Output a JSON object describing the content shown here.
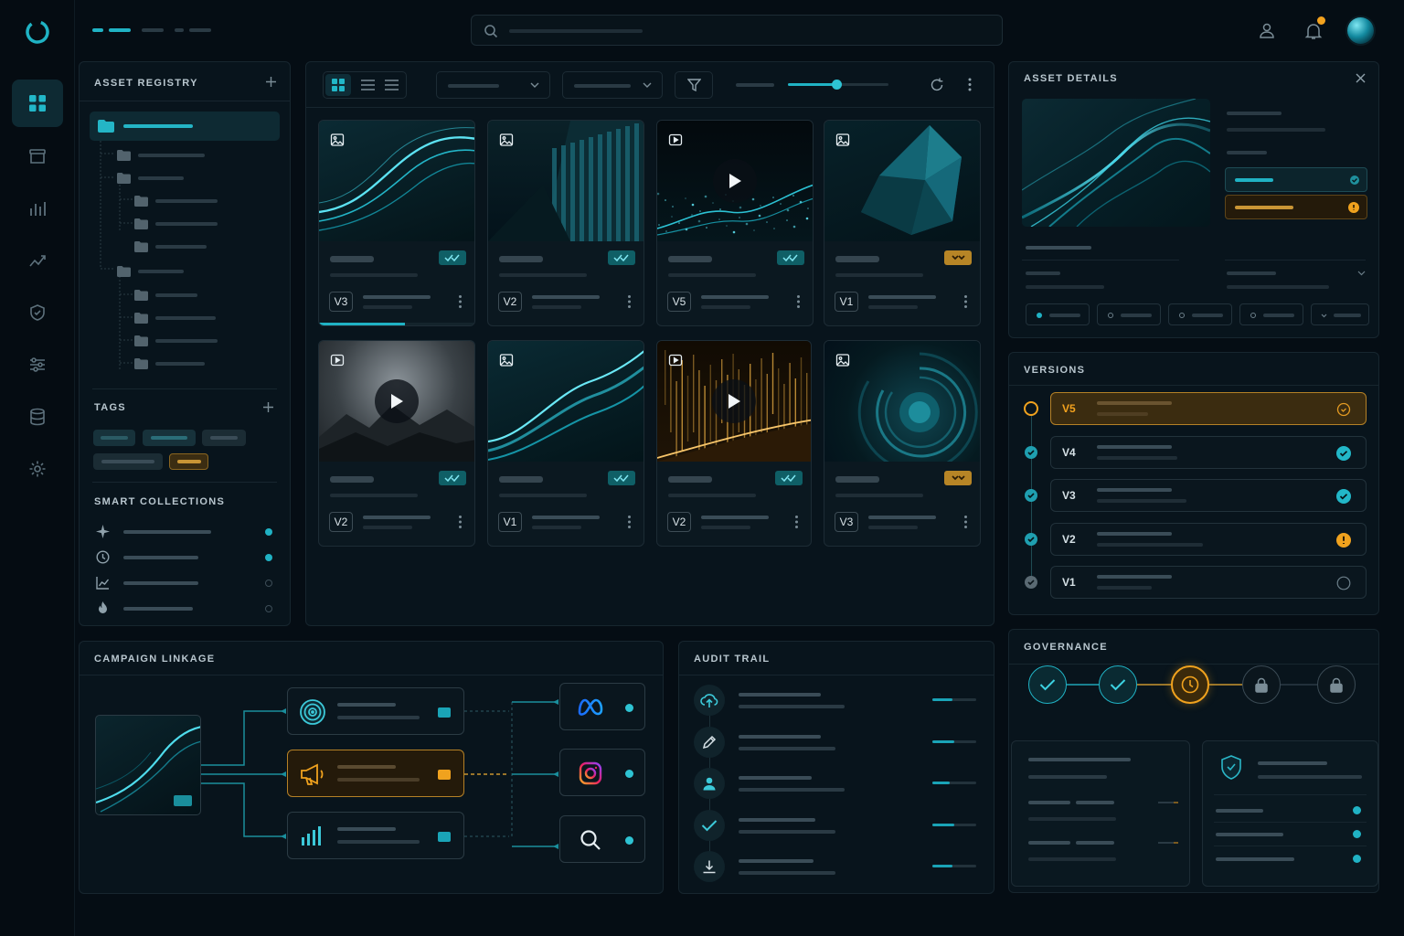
{
  "colors": {
    "bg": "#050d14",
    "panel": "#08141c",
    "accent": "#20b2c4",
    "warning": "#d99a2b",
    "border": "#17262f"
  },
  "rail": {
    "logo": "ring-logo-icon",
    "items": [
      {
        "icon": "grid-icon",
        "active": true
      },
      {
        "icon": "archive-icon"
      },
      {
        "icon": "bar-chart-icon"
      },
      {
        "icon": "trend-icon"
      },
      {
        "icon": "shield-icon"
      },
      {
        "icon": "sliders-icon"
      },
      {
        "icon": "database-icon"
      },
      {
        "icon": "settings-icon"
      }
    ]
  },
  "header": {
    "search_icon": "search-icon",
    "user_icon": "user-icon",
    "bell_icon": "bell-icon",
    "notification_dot": true
  },
  "registry": {
    "title": "ASSET REGISTRY",
    "tags_title": "TAGS",
    "smart_title": "SMART COLLECTIONS",
    "smart_items": [
      {
        "icon": "sparkle-icon",
        "active": true
      },
      {
        "icon": "clock-icon",
        "active": true
      },
      {
        "icon": "chart-icon",
        "active": false
      },
      {
        "icon": "flame-icon",
        "active": false
      }
    ]
  },
  "grid": {
    "cards": [
      {
        "type": "image",
        "version": "V3",
        "status": "ok",
        "progress": 0.55
      },
      {
        "type": "image",
        "version": "V2",
        "status": "ok"
      },
      {
        "type": "video",
        "version": "V5",
        "status": "ok"
      },
      {
        "type": "image",
        "version": "V1",
        "status": "warn"
      },
      {
        "type": "video",
        "version": "V2",
        "status": "ok"
      },
      {
        "type": "image",
        "version": "V1",
        "status": "ok"
      },
      {
        "type": "video",
        "version": "V2",
        "status": "ok"
      },
      {
        "type": "image",
        "version": "V3",
        "status": "warn"
      }
    ],
    "zoom_level": 0.48
  },
  "details": {
    "title": "ASSET DETAILS",
    "close_icon": "close-icon"
  },
  "versions": {
    "title": "VERSIONS",
    "items": [
      {
        "label": "V5",
        "state": "current",
        "status": "pending"
      },
      {
        "label": "V4",
        "state": "done",
        "status": "approved"
      },
      {
        "label": "V3",
        "state": "done",
        "status": "approved"
      },
      {
        "label": "V2",
        "state": "done",
        "status": "warning"
      },
      {
        "label": "V1",
        "state": "old",
        "status": "none"
      }
    ]
  },
  "governance": {
    "title": "GOVERNANCE",
    "steps": [
      "done",
      "done",
      "pending",
      "locked",
      "locked"
    ]
  },
  "campaign": {
    "title": "CAMPAIGN LINKAGE",
    "platforms": [
      "meta-icon",
      "instagram-icon",
      "search-icon"
    ]
  },
  "audit": {
    "title": "AUDIT TRAIL",
    "events": [
      {
        "icon": "upload-icon",
        "progress": 0.45
      },
      {
        "icon": "edit-icon",
        "progress": 0.5
      },
      {
        "icon": "user-icon",
        "progress": 0.4
      },
      {
        "icon": "check-icon",
        "progress": 0.5
      },
      {
        "icon": "download-icon",
        "progress": 0.45
      }
    ]
  }
}
